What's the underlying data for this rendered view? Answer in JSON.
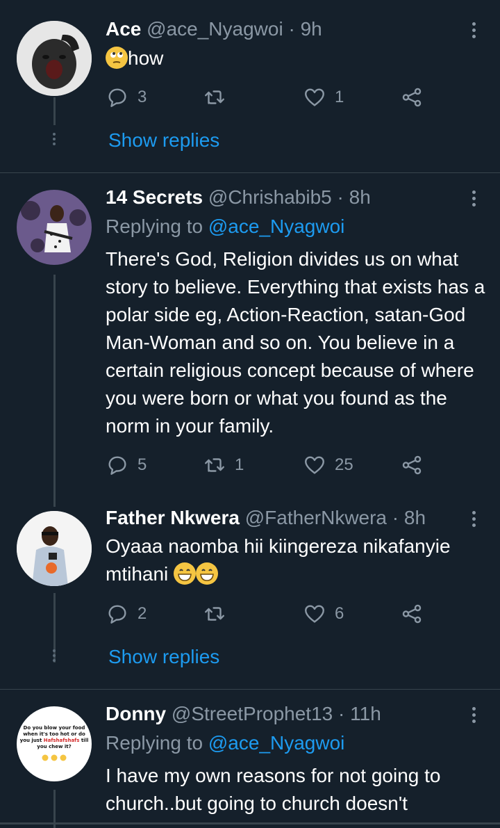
{
  "tweets": [
    {
      "name": "Ace",
      "handle": "@ace_Nyagwoi",
      "separator": "·",
      "time": "9h",
      "text": "how",
      "emoji": "face-with-rolling-eyes",
      "replies": "3",
      "retweets": "",
      "likes": "1",
      "show_replies": "Show replies"
    },
    {
      "name": "14 Secrets",
      "handle": "@Chrishabib5",
      "separator": "·",
      "time": "8h",
      "replying_label": "Replying to",
      "replying_to": "@ace_Nyagwoi",
      "text": "There's God, Religion divides us on what story to believe. Everything that exists has a polar side eg, Action-Reaction, satan-God Man-Woman and so on. You believe in a certain religious concept because of where you were born or what you found as the norm in your family.",
      "replies": "5",
      "retweets": "1",
      "likes": "25"
    },
    {
      "name": "Father Nkwera",
      "handle": "@FatherNkwera",
      "separator": "·",
      "time": "8h",
      "text": "Oyaaa naomba hii kiingereza nikafanyie mtihani",
      "emoji": "grinning-face",
      "replies": "2",
      "retweets": "",
      "likes": "6",
      "show_replies": "Show replies"
    },
    {
      "name": "Donny",
      "handle": "@StreetProphet13",
      "separator": "·",
      "time": "11h",
      "replying_label": "Replying to",
      "replying_to": "@ace_Nyagwoi",
      "text": "I have my own reasons for not going to church..but going to church doesn't",
      "avatar_text": {
        "line1": "Do you blow your food",
        "line2": "when it's too hot or do",
        "line3_pre": "you just ",
        "line3_em": "Hafshafshafs",
        "line3_post": " till",
        "line4": "you chew it?"
      }
    }
  ],
  "colors": {
    "background": "#15202b",
    "muted": "#8b98a5",
    "accent": "#1d9bf0",
    "divider": "#38444d"
  }
}
